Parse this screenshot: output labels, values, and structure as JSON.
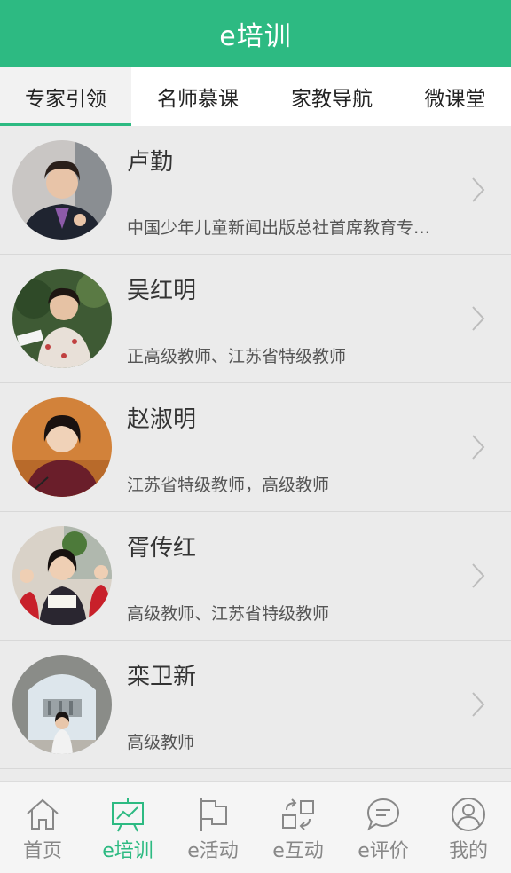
{
  "header": {
    "title": "e培训"
  },
  "tabs": [
    {
      "label": "专家引领",
      "active": true
    },
    {
      "label": "名师慕课",
      "active": false
    },
    {
      "label": "家教导航",
      "active": false
    },
    {
      "label": "微课堂",
      "active": false
    }
  ],
  "experts": [
    {
      "name": "卢勤",
      "desc": "中国少年儿童新闻出版总社首席教育专…"
    },
    {
      "name": "吴红明",
      "desc": "正高级教师、江苏省特级教师"
    },
    {
      "name": "赵淑明",
      "desc": "江苏省特级教师，高级教师"
    },
    {
      "name": "胥传红",
      "desc": "高级教师、江苏省特级教师"
    },
    {
      "name": "栾卫新",
      "desc": "高级教师"
    }
  ],
  "tabbar": [
    {
      "label": "首页",
      "icon": "home-icon",
      "active": false
    },
    {
      "label": "e培训",
      "icon": "presentation-board-icon",
      "active": true
    },
    {
      "label": "e活动",
      "icon": "flag-icon",
      "active": false
    },
    {
      "label": "e互动",
      "icon": "exchange-icon",
      "active": false
    },
    {
      "label": "e评价",
      "icon": "chat-bubble-icon",
      "active": false
    },
    {
      "label": "我的",
      "icon": "user-profile-icon",
      "active": false
    }
  ],
  "colors": {
    "accent": "#2dba82",
    "inactive": "#888888"
  }
}
